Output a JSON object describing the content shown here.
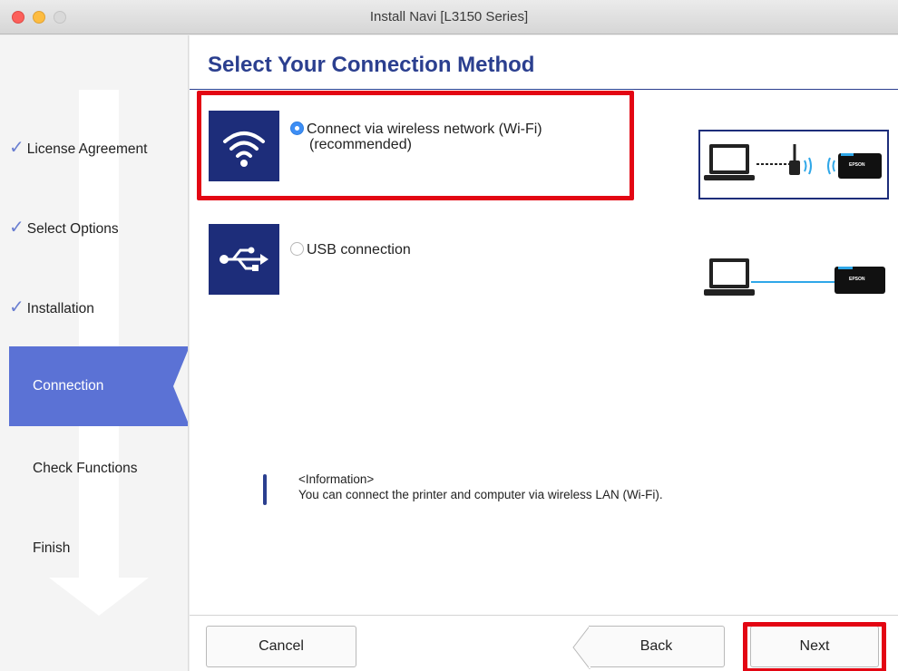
{
  "window": {
    "title": "Install Navi [L3150 Series]"
  },
  "sidebar": {
    "steps": [
      {
        "label": "License Agreement",
        "state": "done"
      },
      {
        "label": "Select Options",
        "state": "done"
      },
      {
        "label": "Installation",
        "state": "done"
      },
      {
        "label": "Connection",
        "state": "current"
      },
      {
        "label": "Check Functions",
        "state": "pending"
      },
      {
        "label": "Finish",
        "state": "pending"
      }
    ],
    "checkmark": "✓"
  },
  "main": {
    "heading": "Select Your Connection Method",
    "options": [
      {
        "line1": "Connect via wireless network (Wi-Fi)",
        "line2": "(recommended)",
        "selected": true,
        "icon": "wifi-icon"
      },
      {
        "line1": "USB connection",
        "selected": false,
        "icon": "usb-icon"
      }
    ],
    "diagram_labels": {
      "printer_brand": "EPSON"
    },
    "info": {
      "title": "<Information>",
      "text": "You can connect the printer and computer via wireless LAN (Wi-Fi)."
    }
  },
  "footer": {
    "cancel": "Cancel",
    "back": "Back",
    "next": "Next"
  },
  "colors": {
    "accent": "#5b72d5",
    "heading": "#2b3f8f",
    "icon_bg": "#1d2d7a",
    "highlight": "#e30613",
    "radio": "#3d8ef5"
  }
}
